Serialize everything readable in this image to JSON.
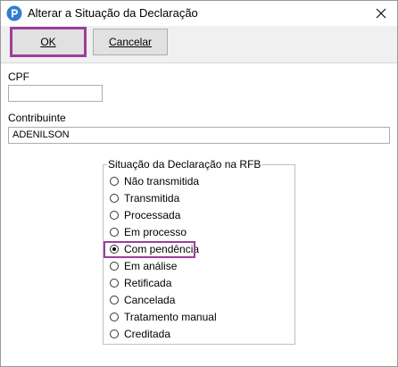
{
  "window": {
    "title": "Alterar a Situação da Declaração"
  },
  "toolbar": {
    "ok_label": "OK",
    "cancel_label": "Cancelar"
  },
  "form": {
    "cpf_label": "CPF",
    "cpf_value": "",
    "contribuinte_label": "Contribuinte",
    "contribuinte_value": "ADENILSON"
  },
  "situacao": {
    "title": "Situação da Declaração na RFB",
    "selected": "Com pendência",
    "options": [
      "Não transmitida",
      "Transmitida",
      "Processada",
      "Em processo",
      "Com pendência",
      "Em análise",
      "Retificada",
      "Cancelada",
      "Tratamento manual",
      "Creditada"
    ]
  },
  "colors": {
    "highlight": "#9b3f9a",
    "app_icon": "#2f7fd0"
  },
  "icons": {
    "app": "app-logo-icon",
    "close": "close-icon"
  }
}
